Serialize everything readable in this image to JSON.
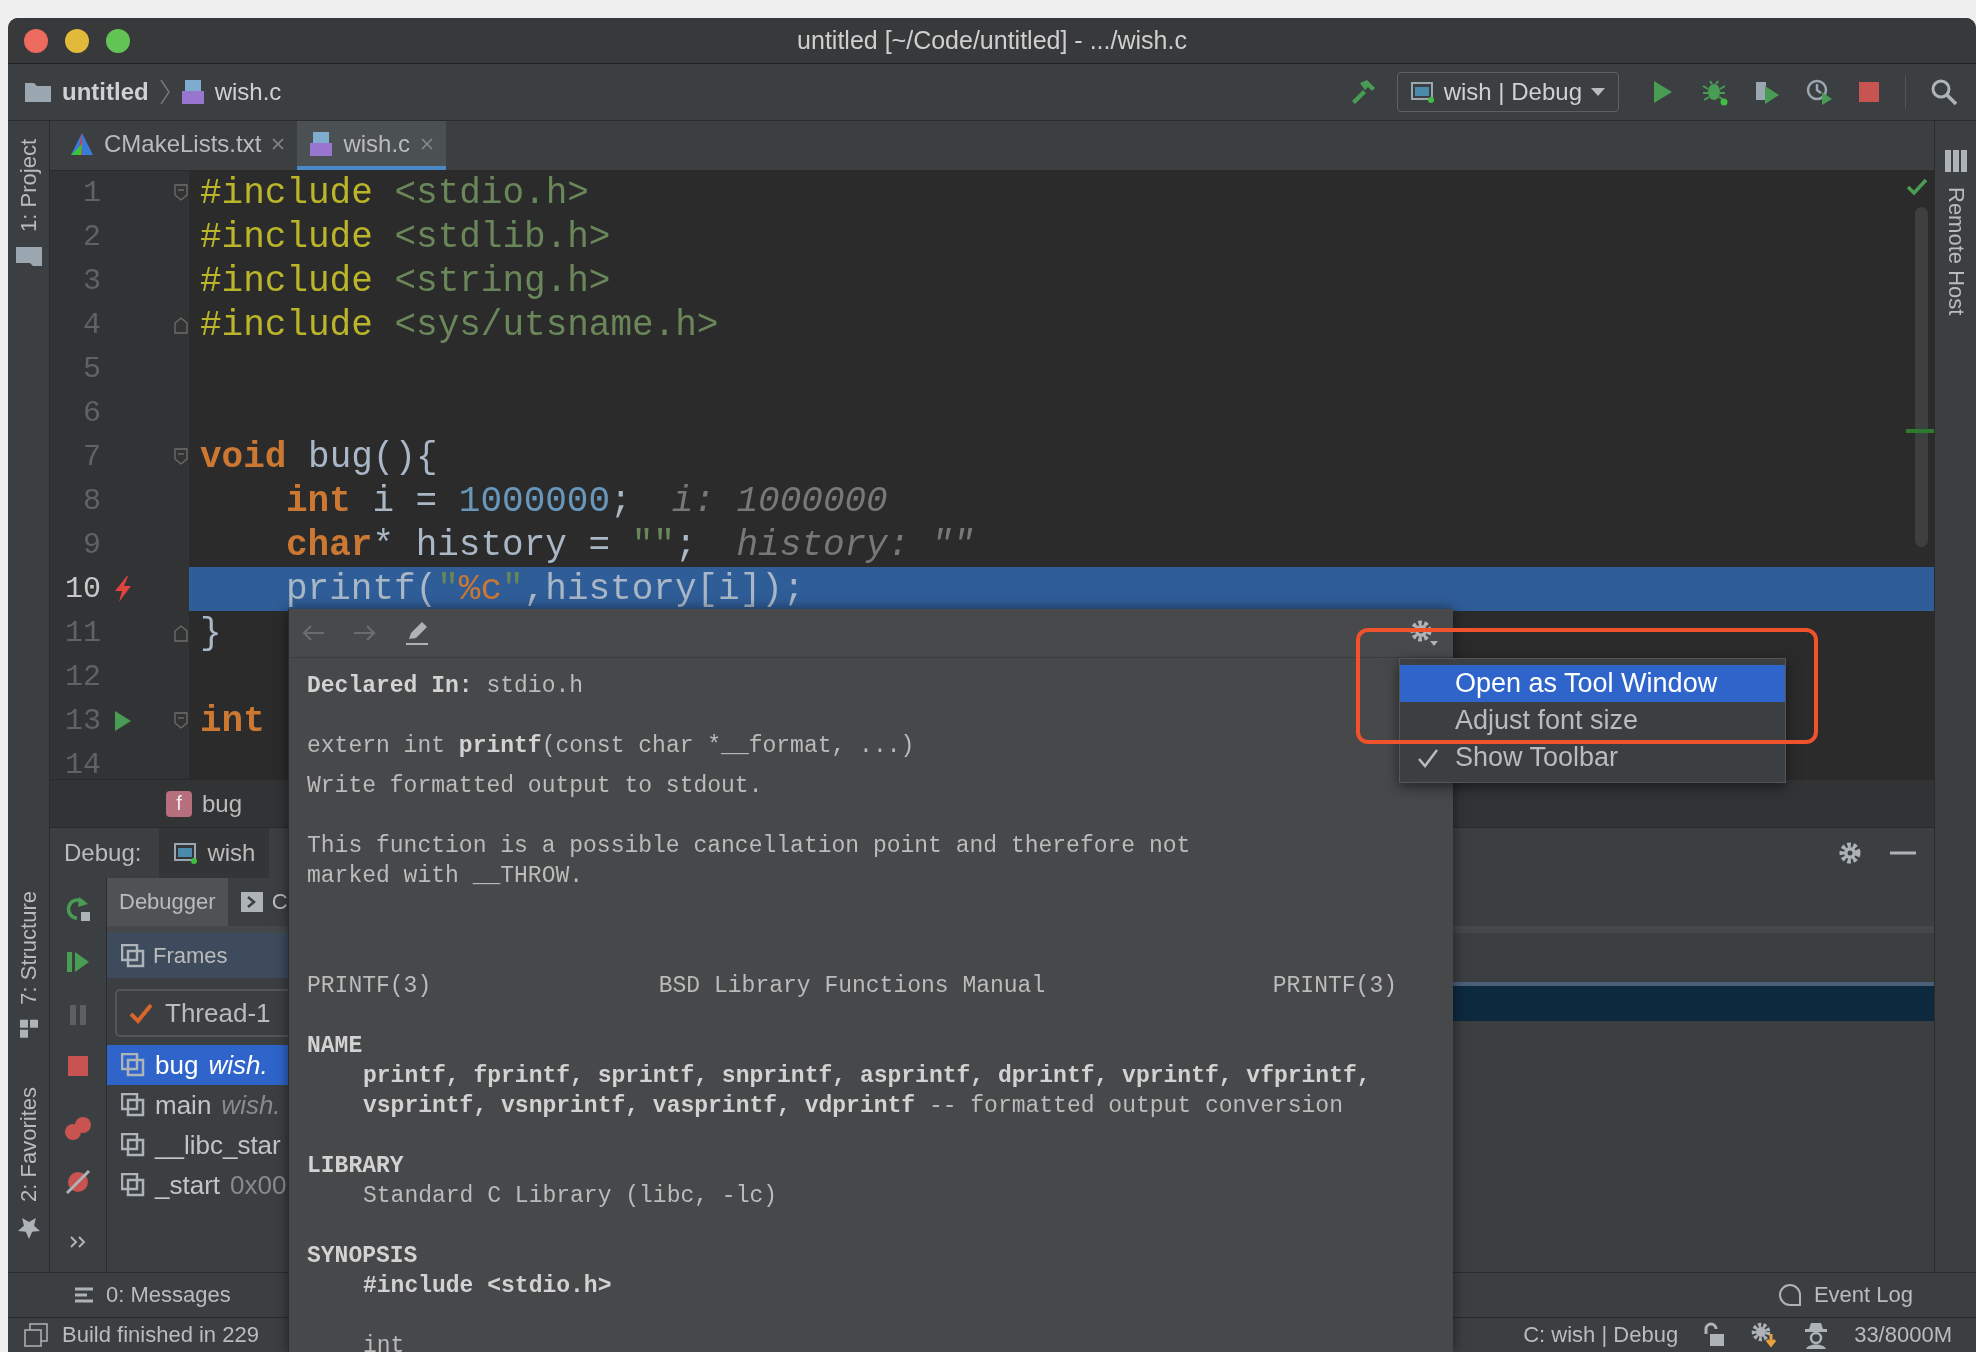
{
  "window": {
    "title": "untitled [~/Code/untitled] - .../wish.c"
  },
  "navigation_bar": {
    "breadcrumbs": [
      {
        "label": "untitled",
        "kind": "folder"
      },
      {
        "label": "wish.c",
        "kind": "file"
      }
    ],
    "run_configuration": "wish | Debug"
  },
  "left_stripe": [
    {
      "label": "1: Project",
      "kind": "project"
    },
    {
      "label": "7: Structure",
      "kind": "structure"
    },
    {
      "label": "2: Favorites",
      "kind": "favorites"
    }
  ],
  "right_stripe": [
    {
      "label": "Remote Host",
      "kind": "remote"
    }
  ],
  "editor_tabs": [
    {
      "label": "CMakeLists.txt",
      "kind": "cmake",
      "selected": false
    },
    {
      "label": "wish.c",
      "kind": "c",
      "selected": true
    }
  ],
  "editor": {
    "lines": [
      {
        "number": "1",
        "current": false,
        "kind": "top",
        "fold": {
          "kind": "start"
        },
        "tokens": [
          {
            "kind": "directive",
            "text": "#include"
          },
          {
            "kind": "header",
            "text": "<stdio.h>"
          }
        ]
      },
      {
        "number": "2",
        "current": false,
        "kind": "top",
        "tokens": [
          {
            "kind": "directive",
            "text": "#include"
          },
          {
            "kind": "header",
            "text": "<stdlib.h>"
          }
        ]
      },
      {
        "number": "3",
        "current": false,
        "kind": "top",
        "tokens": [
          {
            "kind": "directive",
            "text": "#include"
          },
          {
            "kind": "header",
            "text": "<string.h>"
          }
        ]
      },
      {
        "number": "4",
        "current": false,
        "kind": "top",
        "fold": {
          "kind": "end"
        },
        "tokens": [
          {
            "kind": "directive",
            "text": "#include"
          },
          {
            "kind": "header",
            "text": "<sys/utsname.h>"
          }
        ]
      },
      {
        "number": "5",
        "current": false,
        "kind": "top"
      },
      {
        "number": "6",
        "current": false,
        "kind": "top"
      },
      {
        "number": "7",
        "current": false,
        "kind": "top",
        "fold": {
          "kind": "start"
        },
        "tokens": [
          {
            "kind": "keyword",
            "text": "void"
          },
          {
            "kind": "plain",
            "text": " bug(){"
          }
        ]
      },
      {
        "number": "8",
        "current": false,
        "kind": "nested",
        "tokens": [
          {
            "kind": "keyword",
            "text": "int"
          },
          {
            "kind": "plain",
            "text": " i = "
          },
          {
            "kind": "number",
            "text": "1000000"
          },
          {
            "kind": "plain",
            "text": ";"
          }
        ],
        "hint": "i: 1000000"
      },
      {
        "number": "9",
        "current": false,
        "kind": "nested",
        "tokens": [
          {
            "kind": "keyword",
            "text": "char"
          },
          {
            "kind": "plain",
            "text": "* history = "
          },
          {
            "kind": "string",
            "text": "\"\""
          },
          {
            "kind": "plain",
            "text": ";"
          }
        ],
        "hint": "history: \"\""
      },
      {
        "number": "10",
        "current": true,
        "kind": "nested",
        "gutter_icon": {
          "kind": "breakpoint"
        },
        "tokens": [
          {
            "kind": "plain",
            "text": "printf("
          },
          {
            "kind": "string",
            "text": "\""
          },
          {
            "kind": "format",
            "text": "%c"
          },
          {
            "kind": "string",
            "text": "\""
          },
          {
            "kind": "plain",
            "text": ",history[i]);"
          }
        ]
      },
      {
        "number": "11",
        "current": false,
        "kind": "top",
        "fold": {
          "kind": "end"
        },
        "tokens": [
          {
            "kind": "plain",
            "text": "}"
          }
        ]
      },
      {
        "number": "12",
        "current": false,
        "kind": "top"
      },
      {
        "number": "13",
        "current": false,
        "kind": "top",
        "gutter_icon": {
          "kind": "run"
        },
        "fold": {
          "kind": "start"
        },
        "tokens": [
          {
            "kind": "keyword",
            "text": "int"
          }
        ]
      },
      {
        "number": "14",
        "current": false,
        "kind": "top"
      }
    ]
  },
  "breadcrumb": {
    "badge": "f",
    "label": "bug"
  },
  "debug": {
    "title": "Debug:",
    "session": "wish",
    "tabs": [
      {
        "label": "Debugger",
        "kind": "debugger",
        "selected": true
      },
      {
        "label": "C",
        "kind": "console",
        "selected": false
      }
    ],
    "frames_title": "Frames",
    "thread": "Thread-1",
    "frames": [
      {
        "function": "bug",
        "location": "wish.",
        "kind": "source",
        "selected": true
      },
      {
        "function": "main",
        "location": "wish.",
        "kind": "source",
        "selected": false
      },
      {
        "function": "__libc_star",
        "selected": false
      },
      {
        "function": "_start",
        "location": "0x00",
        "kind": "address",
        "selected": false
      }
    ]
  },
  "bottom_bar": {
    "messages": "0: Messages",
    "event_log": "Event Log"
  },
  "status_bar": {
    "message": "Build finished in 229",
    "configuration": "C: wish | Debug",
    "memory": "33/8000M"
  },
  "documentation_popup": {
    "blocks": [
      {
        "kind": "declared",
        "text": "**Declared In:** stdio.h"
      },
      {
        "kind": "signature",
        "text": "extern int **printf**(const char *__format, ...)"
      },
      {
        "kind": "summary",
        "text": "Write formatted output to stdout."
      },
      {
        "kind": "note",
        "text": "This function is a possible cancellation point and therefore not\nmarked with __THROW."
      },
      {
        "kind": "man_header",
        "columns": [
          "PRINTF(3)",
          "BSD Library Functions Manual",
          "PRINTF(3)"
        ]
      },
      {
        "kind": "section",
        "heading": "NAME",
        "body": "**printf, fprintf, sprintf, snprintf, asprintf, dprintf, vprintf, vfprintf,\nvsprintf, vsnprintf, vasprintf, vdprintf** -- formatted output conversion"
      },
      {
        "kind": "section",
        "heading": "LIBRARY",
        "body": "Standard C Library (libc, -lc)"
      },
      {
        "kind": "section",
        "heading": "SYNOPSIS",
        "body": "**#include <stdio.h>**\n\nint"
      }
    ]
  },
  "popup_menu": {
    "items": [
      {
        "label": "Open as Tool Window",
        "selected": true,
        "checked": false
      },
      {
        "label": "Adjust font size",
        "selected": false,
        "checked": false
      },
      {
        "label": "Show Toolbar",
        "selected": false,
        "checked": true
      }
    ]
  }
}
